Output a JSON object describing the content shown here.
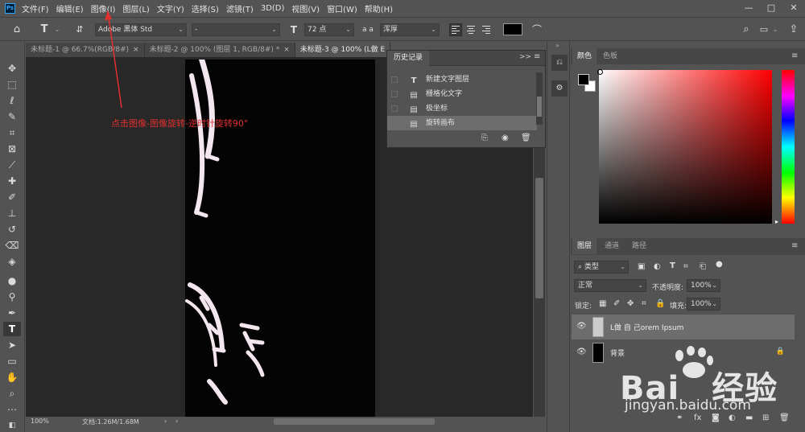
{
  "app": {
    "logo": "Ps",
    "menu": [
      "文件(F)",
      "编辑(E)",
      "图像(I)",
      "图层(L)",
      "文字(Y)",
      "选择(S)",
      "滤镜(T)",
      "3D(D)",
      "视图(V)",
      "窗口(W)",
      "帮助(H)"
    ],
    "window_controls": [
      "—",
      "□",
      "✕"
    ]
  },
  "options": {
    "font_family": "Adobe 黑体 Std",
    "font_style": "-",
    "font_size": "72 点",
    "antialias_label": "a a",
    "antialias_value": "浑厚",
    "color_swatch": "#000000"
  },
  "tabs": [
    {
      "label": "未标题-1 @ 66.7%(RGB/8#)",
      "close": "×"
    },
    {
      "label": "未标题-2 @ 100% (图层 1, RGB/8#) *",
      "close": "×"
    },
    {
      "label": "未标题-3 @ 100% (L做  E",
      "close": ""
    }
  ],
  "status": {
    "zoom": "100%",
    "doc": "文档:1.26M/1.68M"
  },
  "history": {
    "title": "历史记录",
    "items": [
      {
        "icon": "text-tool-icon",
        "label": "新建文字图层",
        "selected": false
      },
      {
        "icon": "document-icon",
        "label": "栅格化文字",
        "selected": false
      },
      {
        "icon": "document-icon",
        "label": "极坐标",
        "selected": false
      },
      {
        "icon": "document-icon",
        "label": "旋转画布",
        "selected": true
      }
    ]
  },
  "color_panel": {
    "tabs": [
      "颜色",
      "色板"
    ],
    "foreground": "#000000",
    "background": "#ffffff"
  },
  "layers_panel": {
    "tabs": [
      "图层",
      "通道",
      "路径"
    ],
    "filter_kind": "类型",
    "blend_mode": "正常",
    "opacity_label": "不透明度:",
    "opacity": "100%",
    "lock_label": "锁定:",
    "fill_label": "填充:",
    "fill": "100%",
    "layers": [
      {
        "name": "L做  自  己orem Ipsum",
        "selected": true,
        "locked": false
      },
      {
        "name": "背景",
        "selected": false,
        "locked": true
      }
    ]
  },
  "annotation": {
    "text": "点击图像-图像旋转-逆时针旋转90°",
    "color": "#e03030"
  },
  "watermark": {
    "text1": "Bai",
    "text2": "经验",
    "url": "jingyan.baidu.com"
  }
}
